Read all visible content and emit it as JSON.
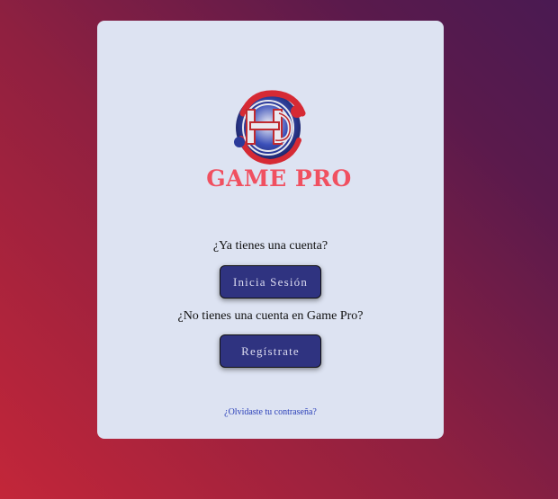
{
  "brand": {
    "name": "GAME PRO",
    "color": "#f05060",
    "logo_icon": "game-pro-logo-icon"
  },
  "login": {
    "prompt": "¿Ya tienes una cuenta?",
    "button_label": "Inicia Sesión"
  },
  "register": {
    "prompt": "¿No tienes una cuenta en Game Pro?",
    "button_label": "Regístrate"
  },
  "forgot_password": {
    "link_text": "¿Olvidaste tu contraseña?"
  },
  "colors": {
    "card_background": "#dde3f2",
    "button_background": "#2f3380",
    "link": "#2a3fb8"
  }
}
